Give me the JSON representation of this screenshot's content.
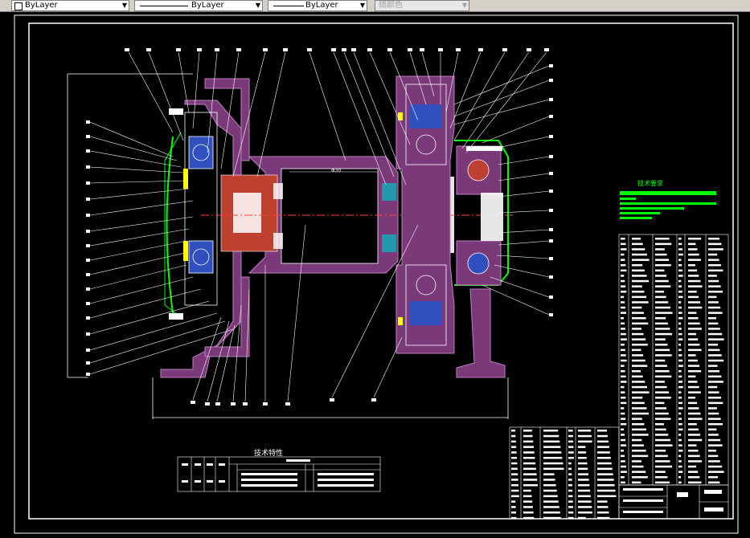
{
  "toolbar": {
    "color_control": {
      "value": "ByLayer"
    },
    "linetype_control": {
      "value": "ByLayer"
    },
    "lineweight_control": {
      "value": "ByLayer"
    },
    "plotstyle_control": {
      "value": "随颜色"
    }
  },
  "drawing": {
    "tech_char_title": "技术特性",
    "tech_req_title": "技术要求",
    "dimension_center": "Φ30"
  },
  "colors": {
    "background": "#000000",
    "frame": "#ffffff",
    "section_fill": "#7a3a7a",
    "part_fill": "#c04030",
    "green": "#00ff00",
    "yellow": "#ffff00",
    "blue": "#3050c0",
    "cyan": "#00c0c0"
  }
}
